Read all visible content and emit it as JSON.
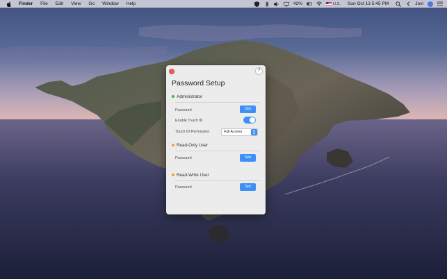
{
  "menubar": {
    "apple_icon": "apple-icon",
    "app_name": "Finder",
    "menus": [
      "File",
      "Edit",
      "View",
      "Go",
      "Window",
      "Help"
    ],
    "battery": "42%",
    "input_source": "U.S.",
    "clock": "Sun Oct 13  5:45 PM",
    "user": "Jovi"
  },
  "window": {
    "title": "Password Setup",
    "help": "?",
    "sections": [
      {
        "label": "Administrator",
        "dot_color": "#41b33c"
      },
      {
        "label": "Read-Only User",
        "dot_color": "#f0a32b"
      },
      {
        "label": "Read-Write User",
        "dot_color": "#f0a32b"
      }
    ],
    "admin": {
      "password_label": "Password",
      "set_label": "Set",
      "touch_id_label": "Enable Touch ID",
      "touch_id_enabled": true,
      "permission_label": "Touch ID Permission",
      "permission_value": "Full Access"
    },
    "readonly": {
      "password_label": "Password",
      "set_label": "Set"
    },
    "readwrite": {
      "password_label": "Password",
      "set_label": "Set"
    }
  },
  "colors": {
    "accent": "#3e8ff6",
    "close": "#ed5f56"
  }
}
